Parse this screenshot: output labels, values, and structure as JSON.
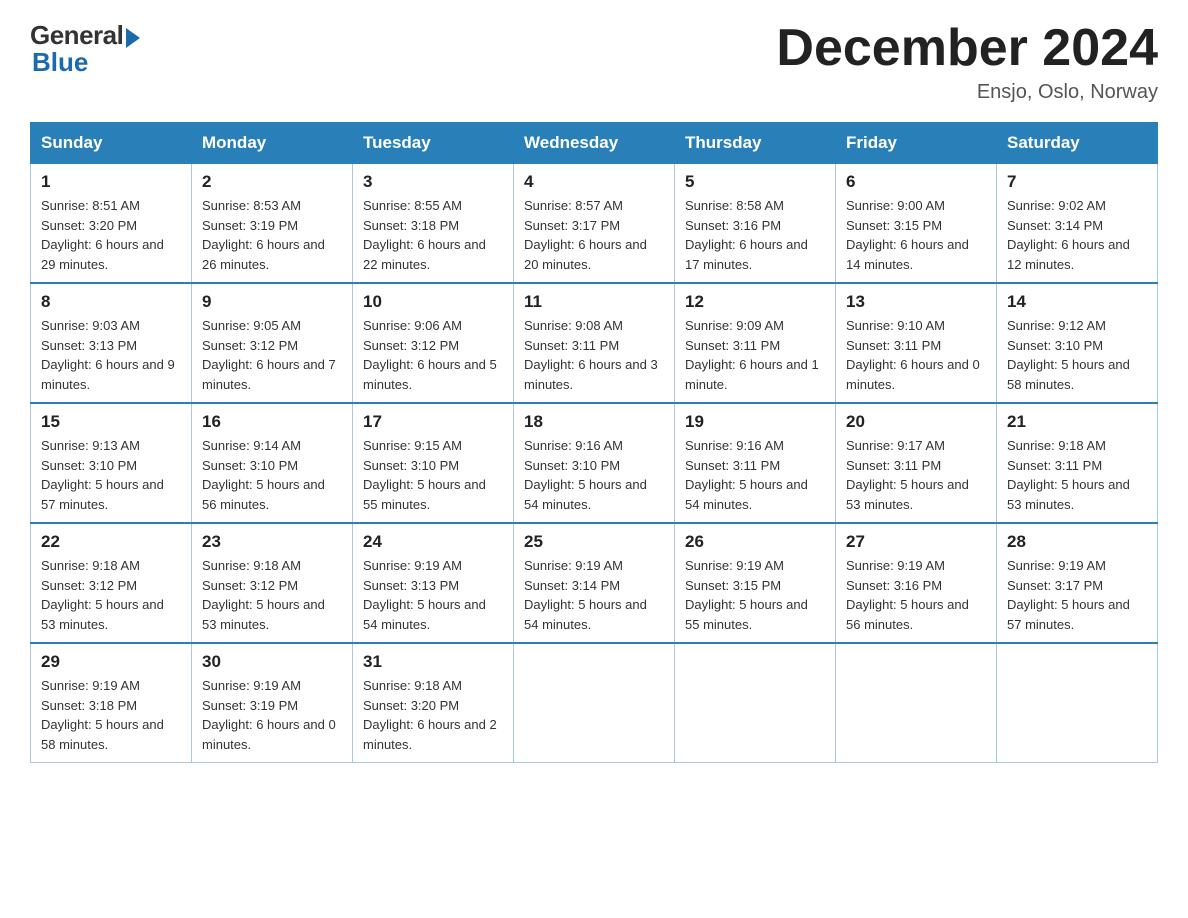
{
  "header": {
    "logo_general": "General",
    "logo_blue": "Blue",
    "title": "December 2024",
    "location": "Ensjo, Oslo, Norway"
  },
  "weekdays": [
    "Sunday",
    "Monday",
    "Tuesday",
    "Wednesday",
    "Thursday",
    "Friday",
    "Saturday"
  ],
  "weeks": [
    [
      {
        "day": "1",
        "sunrise": "Sunrise: 8:51 AM",
        "sunset": "Sunset: 3:20 PM",
        "daylight": "Daylight: 6 hours and 29 minutes."
      },
      {
        "day": "2",
        "sunrise": "Sunrise: 8:53 AM",
        "sunset": "Sunset: 3:19 PM",
        "daylight": "Daylight: 6 hours and 26 minutes."
      },
      {
        "day": "3",
        "sunrise": "Sunrise: 8:55 AM",
        "sunset": "Sunset: 3:18 PM",
        "daylight": "Daylight: 6 hours and 22 minutes."
      },
      {
        "day": "4",
        "sunrise": "Sunrise: 8:57 AM",
        "sunset": "Sunset: 3:17 PM",
        "daylight": "Daylight: 6 hours and 20 minutes."
      },
      {
        "day": "5",
        "sunrise": "Sunrise: 8:58 AM",
        "sunset": "Sunset: 3:16 PM",
        "daylight": "Daylight: 6 hours and 17 minutes."
      },
      {
        "day": "6",
        "sunrise": "Sunrise: 9:00 AM",
        "sunset": "Sunset: 3:15 PM",
        "daylight": "Daylight: 6 hours and 14 minutes."
      },
      {
        "day": "7",
        "sunrise": "Sunrise: 9:02 AM",
        "sunset": "Sunset: 3:14 PM",
        "daylight": "Daylight: 6 hours and 12 minutes."
      }
    ],
    [
      {
        "day": "8",
        "sunrise": "Sunrise: 9:03 AM",
        "sunset": "Sunset: 3:13 PM",
        "daylight": "Daylight: 6 hours and 9 minutes."
      },
      {
        "day": "9",
        "sunrise": "Sunrise: 9:05 AM",
        "sunset": "Sunset: 3:12 PM",
        "daylight": "Daylight: 6 hours and 7 minutes."
      },
      {
        "day": "10",
        "sunrise": "Sunrise: 9:06 AM",
        "sunset": "Sunset: 3:12 PM",
        "daylight": "Daylight: 6 hours and 5 minutes."
      },
      {
        "day": "11",
        "sunrise": "Sunrise: 9:08 AM",
        "sunset": "Sunset: 3:11 PM",
        "daylight": "Daylight: 6 hours and 3 minutes."
      },
      {
        "day": "12",
        "sunrise": "Sunrise: 9:09 AM",
        "sunset": "Sunset: 3:11 PM",
        "daylight": "Daylight: 6 hours and 1 minute."
      },
      {
        "day": "13",
        "sunrise": "Sunrise: 9:10 AM",
        "sunset": "Sunset: 3:11 PM",
        "daylight": "Daylight: 6 hours and 0 minutes."
      },
      {
        "day": "14",
        "sunrise": "Sunrise: 9:12 AM",
        "sunset": "Sunset: 3:10 PM",
        "daylight": "Daylight: 5 hours and 58 minutes."
      }
    ],
    [
      {
        "day": "15",
        "sunrise": "Sunrise: 9:13 AM",
        "sunset": "Sunset: 3:10 PM",
        "daylight": "Daylight: 5 hours and 57 minutes."
      },
      {
        "day": "16",
        "sunrise": "Sunrise: 9:14 AM",
        "sunset": "Sunset: 3:10 PM",
        "daylight": "Daylight: 5 hours and 56 minutes."
      },
      {
        "day": "17",
        "sunrise": "Sunrise: 9:15 AM",
        "sunset": "Sunset: 3:10 PM",
        "daylight": "Daylight: 5 hours and 55 minutes."
      },
      {
        "day": "18",
        "sunrise": "Sunrise: 9:16 AM",
        "sunset": "Sunset: 3:10 PM",
        "daylight": "Daylight: 5 hours and 54 minutes."
      },
      {
        "day": "19",
        "sunrise": "Sunrise: 9:16 AM",
        "sunset": "Sunset: 3:11 PM",
        "daylight": "Daylight: 5 hours and 54 minutes."
      },
      {
        "day": "20",
        "sunrise": "Sunrise: 9:17 AM",
        "sunset": "Sunset: 3:11 PM",
        "daylight": "Daylight: 5 hours and 53 minutes."
      },
      {
        "day": "21",
        "sunrise": "Sunrise: 9:18 AM",
        "sunset": "Sunset: 3:11 PM",
        "daylight": "Daylight: 5 hours and 53 minutes."
      }
    ],
    [
      {
        "day": "22",
        "sunrise": "Sunrise: 9:18 AM",
        "sunset": "Sunset: 3:12 PM",
        "daylight": "Daylight: 5 hours and 53 minutes."
      },
      {
        "day": "23",
        "sunrise": "Sunrise: 9:18 AM",
        "sunset": "Sunset: 3:12 PM",
        "daylight": "Daylight: 5 hours and 53 minutes."
      },
      {
        "day": "24",
        "sunrise": "Sunrise: 9:19 AM",
        "sunset": "Sunset: 3:13 PM",
        "daylight": "Daylight: 5 hours and 54 minutes."
      },
      {
        "day": "25",
        "sunrise": "Sunrise: 9:19 AM",
        "sunset": "Sunset: 3:14 PM",
        "daylight": "Daylight: 5 hours and 54 minutes."
      },
      {
        "day": "26",
        "sunrise": "Sunrise: 9:19 AM",
        "sunset": "Sunset: 3:15 PM",
        "daylight": "Daylight: 5 hours and 55 minutes."
      },
      {
        "day": "27",
        "sunrise": "Sunrise: 9:19 AM",
        "sunset": "Sunset: 3:16 PM",
        "daylight": "Daylight: 5 hours and 56 minutes."
      },
      {
        "day": "28",
        "sunrise": "Sunrise: 9:19 AM",
        "sunset": "Sunset: 3:17 PM",
        "daylight": "Daylight: 5 hours and 57 minutes."
      }
    ],
    [
      {
        "day": "29",
        "sunrise": "Sunrise: 9:19 AM",
        "sunset": "Sunset: 3:18 PM",
        "daylight": "Daylight: 5 hours and 58 minutes."
      },
      {
        "day": "30",
        "sunrise": "Sunrise: 9:19 AM",
        "sunset": "Sunset: 3:19 PM",
        "daylight": "Daylight: 6 hours and 0 minutes."
      },
      {
        "day": "31",
        "sunrise": "Sunrise: 9:18 AM",
        "sunset": "Sunset: 3:20 PM",
        "daylight": "Daylight: 6 hours and 2 minutes."
      },
      null,
      null,
      null,
      null
    ]
  ]
}
